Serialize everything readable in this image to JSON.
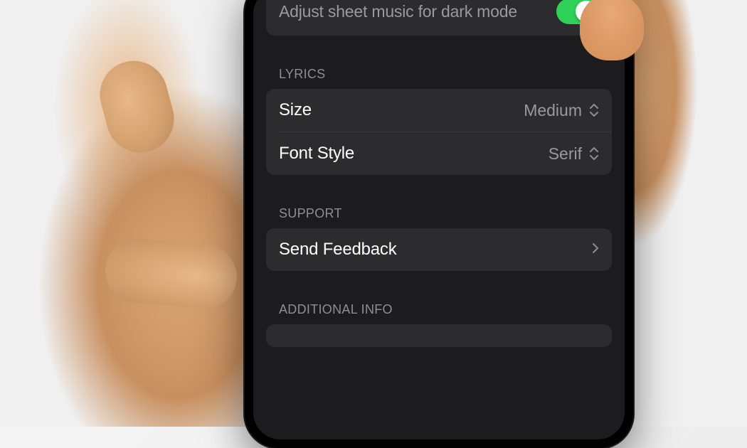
{
  "darkModeRow": {
    "label": "Adjust sheet music for dark mode",
    "toggleOn": true
  },
  "sections": {
    "lyrics": {
      "header": "LYRICS",
      "size": {
        "label": "Size",
        "value": "Medium"
      },
      "fontStyle": {
        "label": "Font Style",
        "value": "Serif"
      }
    },
    "support": {
      "header": "SUPPORT",
      "feedback": {
        "label": "Send Feedback"
      }
    },
    "additionalInfo": {
      "header": "ADDITIONAL INFO"
    }
  },
  "colors": {
    "toggleOn": "#30d158",
    "groupBg": "#2c2c2e",
    "screenBg": "#1c1c1e"
  }
}
